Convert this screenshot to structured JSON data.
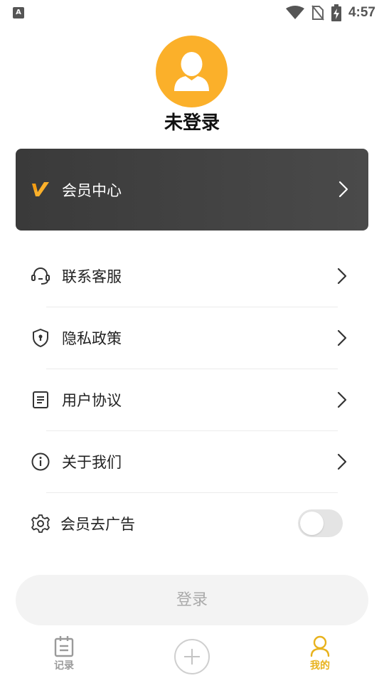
{
  "status_bar": {
    "left_icon": "A",
    "time": "4:57",
    "icons": [
      "wifi-icon",
      "no-sim-icon",
      "battery-charging-icon"
    ]
  },
  "profile": {
    "username": "未登录",
    "avatar_icon": "user-avatar-icon"
  },
  "vip_card": {
    "label": "会员中心",
    "logo_icon": "vip-logo-icon",
    "accent_color": "#fbb02a"
  },
  "menu": {
    "items": [
      {
        "label": "联系客服",
        "icon": "headset-icon"
      },
      {
        "label": "隐私政策",
        "icon": "shield-icon"
      },
      {
        "label": "用户协议",
        "icon": "document-icon"
      },
      {
        "label": "关于我们",
        "icon": "info-icon"
      },
      {
        "label": "会员去广告",
        "icon": "gear-icon",
        "toggle": false
      }
    ]
  },
  "login_button": {
    "label": "登录"
  },
  "bottom_nav": {
    "items": [
      {
        "label": "记录",
        "icon": "calendar-icon",
        "active": false
      },
      {
        "label": "",
        "icon": "add-icon",
        "active": false
      },
      {
        "label": "我的",
        "icon": "person-icon",
        "active": true
      }
    ],
    "active_color": "#e8b21c",
    "inactive_color": "#9a9a9a"
  }
}
